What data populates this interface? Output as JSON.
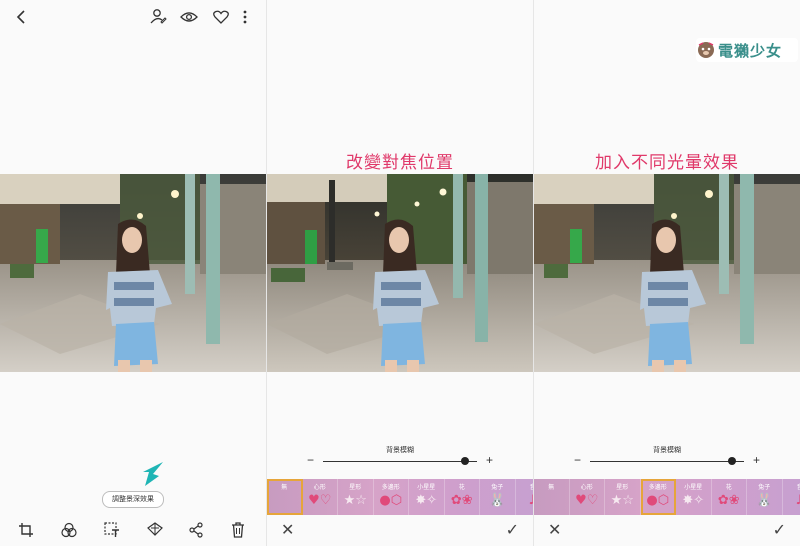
{
  "left_panel": {
    "pill_label": "調整景深效果",
    "top_icons": [
      "back-icon",
      "edit-person-icon",
      "eye-icon",
      "heart-icon",
      "more-icon"
    ],
    "bottom_icons": [
      "crop-icon",
      "filter-icon",
      "text-icon",
      "paint-icon",
      "share-icon",
      "delete-icon"
    ],
    "accent_color": "#1fb5b5"
  },
  "middle_panel": {
    "title": "改變對焦位置",
    "slider_label": "背景模糊",
    "slider_value": 0.92
  },
  "right_panel": {
    "title": "加入不同光暈效果",
    "slider_label": "背景模糊",
    "slider_value": 0.92
  },
  "bokeh_effects": [
    {
      "label": "無",
      "shape": ""
    },
    {
      "label": "心形",
      "shape": "♥♡"
    },
    {
      "label": "星形",
      "shape": "★☆"
    },
    {
      "label": "多邊形",
      "shape": "●⬡"
    },
    {
      "label": "小星星",
      "shape": "✸✧"
    },
    {
      "label": "花",
      "shape": "✿❀"
    },
    {
      "label": "兔子",
      "shape": "🐰"
    },
    {
      "label": "音",
      "shape": "♪"
    }
  ],
  "middle_selected_index": 0,
  "right_selected_index": 3,
  "watermark": {
    "text": "電獺少女"
  },
  "colors": {
    "title": "#e0396a",
    "selection": "#e6a53a"
  }
}
